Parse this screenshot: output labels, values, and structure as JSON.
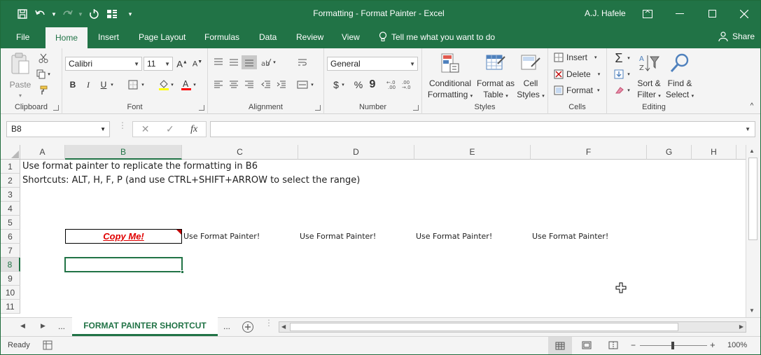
{
  "window": {
    "title": "Formatting - Format Painter  -  Excel",
    "user": "A.J. Hafele"
  },
  "ribbon_tabs": [
    "File",
    "Home",
    "Insert",
    "Page Layout",
    "Formulas",
    "Data",
    "Review",
    "View"
  ],
  "active_tab": "Home",
  "tell_me": "Tell me what you want to do",
  "share": "Share",
  "clipboard": {
    "label": "Clipboard",
    "paste": "Paste"
  },
  "font": {
    "label": "Font",
    "name": "Calibri",
    "size": "11",
    "bold": "B",
    "italic": "I",
    "underline": "U"
  },
  "alignment": {
    "label": "Alignment"
  },
  "number": {
    "label": "Number",
    "format": "General",
    "currency": "$",
    "percent": "%",
    "comma": "9"
  },
  "styles": {
    "label": "Styles",
    "conditional_1": "Conditional",
    "conditional_2": "Formatting",
    "format_as_1": "Format as",
    "format_as_2": "Table",
    "cell_1": "Cell",
    "cell_2": "Styles"
  },
  "cells": {
    "label": "Cells",
    "insert": "Insert",
    "delete": "Delete",
    "format": "Format"
  },
  "editing": {
    "label": "Editing",
    "sort_1": "Sort &",
    "sort_2": "Filter",
    "find_1": "Find &",
    "find_2": "Select"
  },
  "formula_bar": {
    "name_box": "B8",
    "fx": "fx",
    "value": ""
  },
  "columns": [
    "A",
    "B",
    "C",
    "D",
    "E",
    "F",
    "G",
    "H"
  ],
  "selected_column": "B",
  "rows": [
    "1",
    "2",
    "3",
    "4",
    "5",
    "6",
    "7",
    "8",
    "9",
    "10",
    "11"
  ],
  "selected_row": "8",
  "cells_content": {
    "a1": "Use format painter to replicate the formatting in B6",
    "a2": "Shortcuts: ALT, H, F, P (and use CTRL+SHIFT+ARROW to select the range)",
    "b6": "Copy Me!",
    "c6": "Use Format Painter!",
    "d6": "Use Format Painter!",
    "e6": "Use Format Painter!",
    "f6": "Use Format Painter!"
  },
  "sheet_tab": "FORMAT PAINTER SHORTCUT",
  "sheet_nav_more": "...",
  "status": {
    "ready": "Ready",
    "zoom": "100%"
  },
  "colors": {
    "accent": "#217346",
    "copy_me_text": "#ff0000",
    "copy_me_fill": "#c00000"
  }
}
